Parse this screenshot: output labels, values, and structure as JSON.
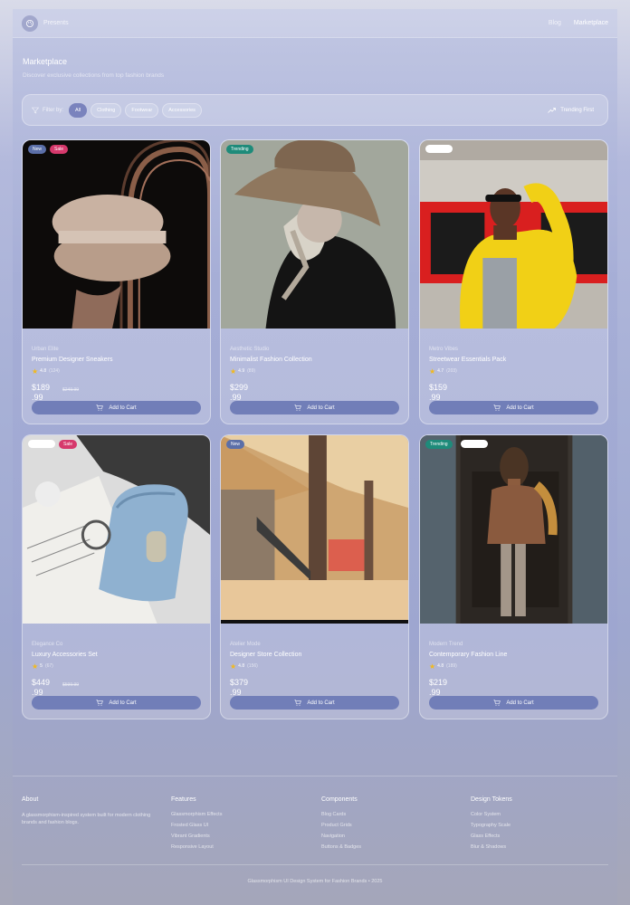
{
  "header": {
    "brand": "Presents",
    "nav": [
      "Blog",
      "Marketplace"
    ]
  },
  "page": {
    "title": "Marketplace",
    "subtitle": "Discover exclusive collections from top fashion brands"
  },
  "filters": {
    "label": "Filter by:",
    "chips": [
      "All",
      "Clothing",
      "Footwear",
      "Accessories"
    ],
    "active": "All",
    "sort": "Trending First"
  },
  "products": [
    {
      "brand": "Urban Elite",
      "name": "Premium Designer Sneakers",
      "rating": "4.8",
      "reviews": "(124)",
      "price": "$189.99",
      "old_price": "$249.99",
      "badges": [
        "New",
        "Sale"
      ],
      "cart": "Add to Cart"
    },
    {
      "brand": "Aesthetic Studio",
      "name": "Minimalist Fashion Collection",
      "rating": "4.9",
      "reviews": "(89)",
      "price": "$299.99",
      "old_price": "",
      "badges": [
        "Trending"
      ],
      "cart": "Add to Cart"
    },
    {
      "brand": "Metro Vibes",
      "name": "Streetwear Essentials Pack",
      "rating": "4.7",
      "reviews": "(203)",
      "price": "$159.99",
      "old_price": "",
      "badges": [
        ""
      ],
      "cart": "Add to Cart"
    },
    {
      "brand": "Elegance Co",
      "name": "Luxury Accessories Set",
      "rating": "5",
      "reviews": "(67)",
      "price": "$449.99",
      "old_price": "$599.99",
      "badges": [
        "",
        "Sale"
      ],
      "cart": "Add to Cart"
    },
    {
      "brand": "Atelier Mode",
      "name": "Designer Store Collection",
      "rating": "4.8",
      "reviews": "(156)",
      "price": "$379.99",
      "old_price": "",
      "badges": [
        "New"
      ],
      "cart": "Add to Cart"
    },
    {
      "brand": "Modern Trend",
      "name": "Contemporary Fashion Line",
      "rating": "4.8",
      "reviews": "(189)",
      "price": "$219.99",
      "old_price": "",
      "badges": [
        "Trending",
        ""
      ],
      "cart": "Add to Cart"
    }
  ],
  "footer": {
    "about_title": "About",
    "about_text": "A glassmorphism-inspired system built for modern clothing brands and fashion blogs.",
    "features_title": "Features",
    "features": [
      "Glassmorphism Effects",
      "Frosted Glass UI",
      "Vibrant Gradients",
      "Responsive Layout"
    ],
    "components_title": "Components",
    "components": [
      "Blog Cards",
      "Product Grids",
      "Navigation",
      "Buttons & Badges"
    ],
    "tokens_title": "Design Tokens",
    "tokens": [
      "Color System",
      "Typography Scale",
      "Glass Effects",
      "Blur & Shadows"
    ],
    "copyright": "Glassmorphism UI Design System for Fashion Brands • 2025"
  }
}
